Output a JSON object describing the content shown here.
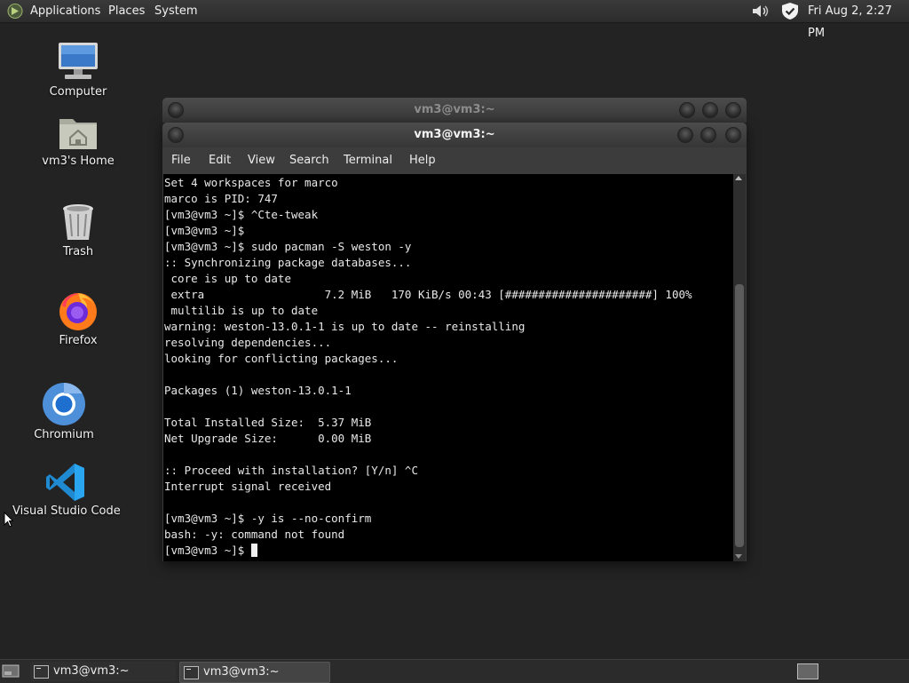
{
  "top_panel": {
    "menus": [
      "Applications",
      "Places",
      "System"
    ],
    "icons": [
      "mate-logo-icon",
      "volume-icon",
      "shield-icon"
    ],
    "clock": "Fri Aug  2,  2:27 PM"
  },
  "desktop_icons": [
    {
      "label": "Computer",
      "icon": "computer-icon"
    },
    {
      "label": "vm3's Home",
      "icon": "home-folder-icon"
    },
    {
      "label": "Trash",
      "icon": "trash-icon"
    },
    {
      "label": "Firefox",
      "icon": "firefox-icon"
    },
    {
      "label": "Chromium",
      "icon": "chromium-icon"
    },
    {
      "label": "Visual Studio Code",
      "icon": "vscode-icon"
    }
  ],
  "back_window": {
    "title": "vm3@vm3:~"
  },
  "front_window": {
    "title": "vm3@vm3:~",
    "menu": [
      "File",
      "Edit",
      "View",
      "Search",
      "Terminal",
      "Help"
    ]
  },
  "terminal": {
    "lines": [
      "Set 4 workspaces for marco",
      "marco is PID: 747",
      "[vm3@vm3 ~]$ ^Cte-tweak",
      "[vm3@vm3 ~]$",
      "[vm3@vm3 ~]$ sudo pacman -S weston -y",
      ":: Synchronizing package databases...",
      " core is up to date",
      " extra                  7.2 MiB   170 KiB/s 00:43 [######################] 100%",
      " multilib is up to date",
      "warning: weston-13.0.1-1 is up to date -- reinstalling",
      "resolving dependencies...",
      "looking for conflicting packages...",
      "",
      "Packages (1) weston-13.0.1-1",
      "",
      "Total Installed Size:  5.37 MiB",
      "Net Upgrade Size:      0.00 MiB",
      "",
      ":: Proceed with installation? [Y/n] ^C",
      "Interrupt signal received",
      "",
      "[vm3@vm3 ~]$ -y is --no-confirm",
      "bash: -y: command not found"
    ],
    "prompt": "[vm3@vm3 ~]$ "
  },
  "taskbar": {
    "tasks": [
      {
        "label": "vm3@vm3:~",
        "active": false
      },
      {
        "label": "vm3@vm3:~",
        "active": true
      }
    ]
  },
  "colors": {
    "desktop": "#232323",
    "terminal_bg": "#000000",
    "terminal_fg": "#e8e8e8"
  }
}
